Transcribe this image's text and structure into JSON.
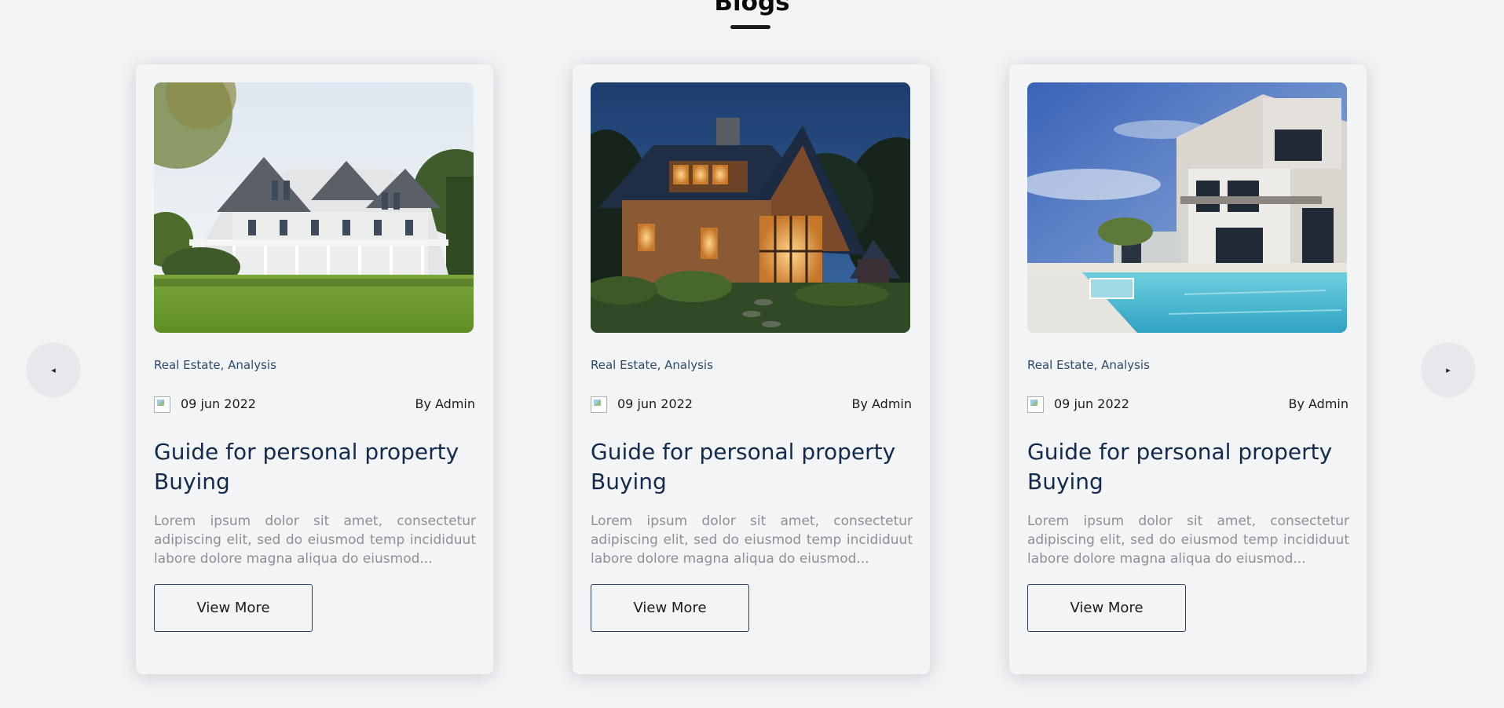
{
  "section": {
    "title": "Blogs"
  },
  "carousel": {
    "prev_glyph": "◂",
    "next_glyph": "▸",
    "prev_icon": "caret-left-icon",
    "next_icon": "caret-right-icon"
  },
  "posts": [
    {
      "image": "white-farmhouse-photo",
      "tags": "Real Estate, Analysis",
      "date": "09 jun 2022",
      "author": "By Admin",
      "title": "Guide for personal property Buying",
      "excerpt": "Lorem ipsum dolor sit amet, consectetur adipiscing elit, sed do eiusmod temp incididuut labore dolore magna aliqua do eiusmod...",
      "button": "View More"
    },
    {
      "image": "lit-cabin-night-photo",
      "tags": "Real Estate, Analysis",
      "date": "09 jun 2022",
      "author": "By Admin",
      "title": "Guide for personal property Buying",
      "excerpt": "Lorem ipsum dolor sit amet, consectetur adipiscing elit, sed do eiusmod temp incididuut labore dolore magna aliqua do eiusmod...",
      "button": "View More"
    },
    {
      "image": "modern-villa-pool-photo",
      "tags": "Real Estate, Analysis",
      "date": "09 jun 2022",
      "author": "By Admin",
      "title": "Guide for personal property Buying",
      "excerpt": "Lorem ipsum dolor sit amet, consectetur adipiscing elit, sed do eiusmod temp incididuut labore dolore magna aliqua do eiusmod...",
      "button": "View More"
    }
  ],
  "colors": {
    "background": "#f1f3f5",
    "card": "#f3f4f6",
    "title": "#122a4c",
    "tags": "#2c4a6a",
    "excerpt": "#8c9096",
    "button_border": "#2b3f5c"
  }
}
